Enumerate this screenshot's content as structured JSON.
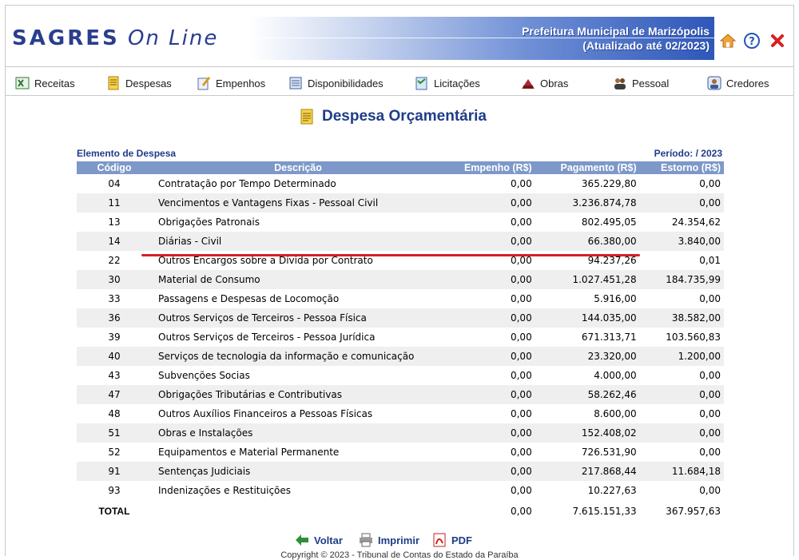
{
  "header": {
    "logo_main": "SAGRES",
    "logo_sub": "On Line",
    "org_line1": "Prefeitura Municipal de Marizópolis",
    "org_line2": "(Atualizado até 02/2023)"
  },
  "nav": [
    {
      "label": "Receitas",
      "icon": "spreadsheet-icon"
    },
    {
      "label": "Despesas",
      "icon": "document-icon"
    },
    {
      "label": "Empenhos",
      "icon": "pencil-note-icon"
    },
    {
      "label": "Disponibilidades",
      "icon": "ledger-icon"
    },
    {
      "label": "Licitações",
      "icon": "clipboard-icon"
    },
    {
      "label": "Obras",
      "icon": "construction-icon"
    },
    {
      "label": "Pessoal",
      "icon": "people-icon"
    },
    {
      "label": "Credores",
      "icon": "person-card-icon"
    }
  ],
  "page": {
    "title": "Despesa Orçamentária",
    "section_label": "Elemento de Despesa",
    "periodo": "Período: / 2023"
  },
  "table": {
    "headers": [
      "Código",
      "Descrição",
      "Empenho (R$)",
      "Pagamento (R$)",
      "Estorno (R$)"
    ],
    "rows": [
      [
        "04",
        "Contratação por Tempo Determinado",
        "0,00",
        "365.229,80",
        "0,00"
      ],
      [
        "11",
        "Vencimentos e Vantagens Fixas - Pessoal Civil",
        "0,00",
        "3.236.874,78",
        "0,00"
      ],
      [
        "13",
        "Obrigações Patronais",
        "0,00",
        "802.495,05",
        "24.354,62"
      ],
      [
        "14",
        "Diárias - Civil",
        "0,00",
        "66.380,00",
        "3.840,00"
      ],
      [
        "22",
        "Outros Encargos sobre a Dívida por Contrato",
        "0,00",
        "94.237,26",
        "0,01"
      ],
      [
        "30",
        "Material de Consumo",
        "0,00",
        "1.027.451,28",
        "184.735,99"
      ],
      [
        "33",
        "Passagens e Despesas de Locomoção",
        "0,00",
        "5.916,00",
        "0,00"
      ],
      [
        "36",
        "Outros Serviços de Terceiros - Pessoa Física",
        "0,00",
        "144.035,00",
        "38.582,00"
      ],
      [
        "39",
        "Outros Serviços de Terceiros - Pessoa Jurídica",
        "0,00",
        "671.313,71",
        "103.560,83"
      ],
      [
        "40",
        "Serviços de tecnologia da informação e comunicação",
        "0,00",
        "23.320,00",
        "1.200,00"
      ],
      [
        "43",
        "Subvenções Socias",
        "0,00",
        "4.000,00",
        "0,00"
      ],
      [
        "47",
        "Obrigações Tributárias e Contributivas",
        "0,00",
        "58.262,46",
        "0,00"
      ],
      [
        "48",
        "Outros Auxílios Financeiros a Pessoas Físicas",
        "0,00",
        "8.600,00",
        "0,00"
      ],
      [
        "51",
        "Obras e Instalações",
        "0,00",
        "152.408,02",
        "0,00"
      ],
      [
        "52",
        "Equipamentos e Material Permanente",
        "0,00",
        "726.531,90",
        "0,00"
      ],
      [
        "91",
        "Sentenças Judiciais",
        "0,00",
        "217.868,44",
        "11.684,18"
      ],
      [
        "93",
        "Indenizações e Restituições",
        "0,00",
        "10.227,63",
        "0,00"
      ]
    ],
    "total": {
      "label": "TOTAL",
      "empenho": "0,00",
      "pagamento": "7.615.151,33",
      "estorno": "367.957,63"
    }
  },
  "actions": {
    "voltar": "Voltar",
    "imprimir": "Imprimir",
    "pdf": "PDF"
  },
  "footer": {
    "copyright": "Copyright © 2023 - Tribunal de Contas do Estado da Paraíba"
  },
  "colors": {
    "header_blue": "#7d98c9",
    "title_blue": "#1f3c88",
    "highlight_red": "#d3202a"
  }
}
